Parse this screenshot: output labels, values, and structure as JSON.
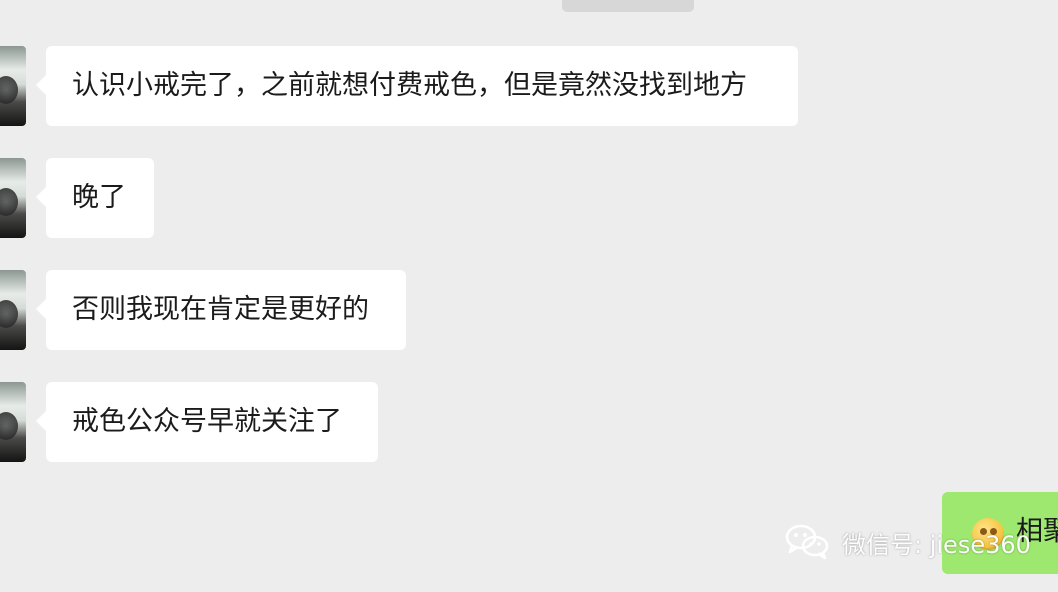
{
  "messages": [
    {
      "text": "认识小戒完了，之前就想付费戒色，但是竟然没找到地方"
    },
    {
      "text": "晚了"
    },
    {
      "text": "否则我现在肯定是更好的"
    },
    {
      "text": "戒色公众号早就关注了"
    }
  ],
  "outgoing_message": {
    "text": "相聚"
  },
  "watermark": {
    "text": "微信号: jiese360"
  },
  "colors": {
    "background": "#eeedee",
    "incoming_bubble": "#ffffff",
    "outgoing_bubble": "#9fe870"
  },
  "icons": {
    "emoji": "emoji-face-icon",
    "watermark_logo": "wechat-logo-icon"
  }
}
